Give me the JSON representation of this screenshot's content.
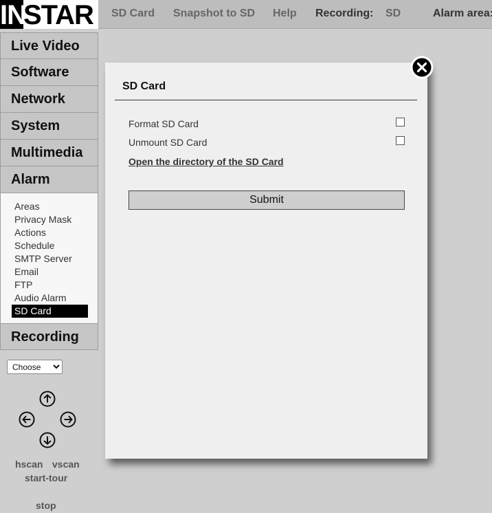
{
  "logo": {
    "part1": "IN",
    "part2": "STAR"
  },
  "topnav": {
    "sd_card": "SD Card",
    "snapshot": "Snapshot to SD",
    "help": "Help",
    "recording_label": "Recording:",
    "recording_value": "SD",
    "alarm_area_label": "Alarm area:"
  },
  "sidebar": {
    "items": [
      {
        "label": "Live Video"
      },
      {
        "label": "Software"
      },
      {
        "label": "Network"
      },
      {
        "label": "System"
      },
      {
        "label": "Multimedia"
      },
      {
        "label": "Alarm"
      }
    ],
    "alarm_submenu": [
      {
        "label": "Areas"
      },
      {
        "label": "Privacy Mask"
      },
      {
        "label": "Actions"
      },
      {
        "label": "Schedule"
      },
      {
        "label": "SMTP Server"
      },
      {
        "label": "Email"
      },
      {
        "label": "FTP"
      },
      {
        "label": "Audio Alarm"
      },
      {
        "label": "SD Card",
        "active": true
      }
    ],
    "recording": "Recording"
  },
  "ptz": {
    "select_value": "Choose",
    "hscan": "hscan",
    "vscan": "vscan",
    "start_tour": "start-tour",
    "stop": "stop"
  },
  "modal": {
    "title": "SD Card",
    "format_label": "Format SD Card",
    "format_checked": false,
    "unmount_label": "Unmount SD Card",
    "unmount_checked": false,
    "open_dir_link": "Open the directory of the SD Card",
    "submit_label": "Submit"
  },
  "icons": {
    "close": "close-icon",
    "up": "arrow-up-icon",
    "down": "arrow-down-icon",
    "left": "arrow-left-icon",
    "right": "arrow-right-icon"
  }
}
